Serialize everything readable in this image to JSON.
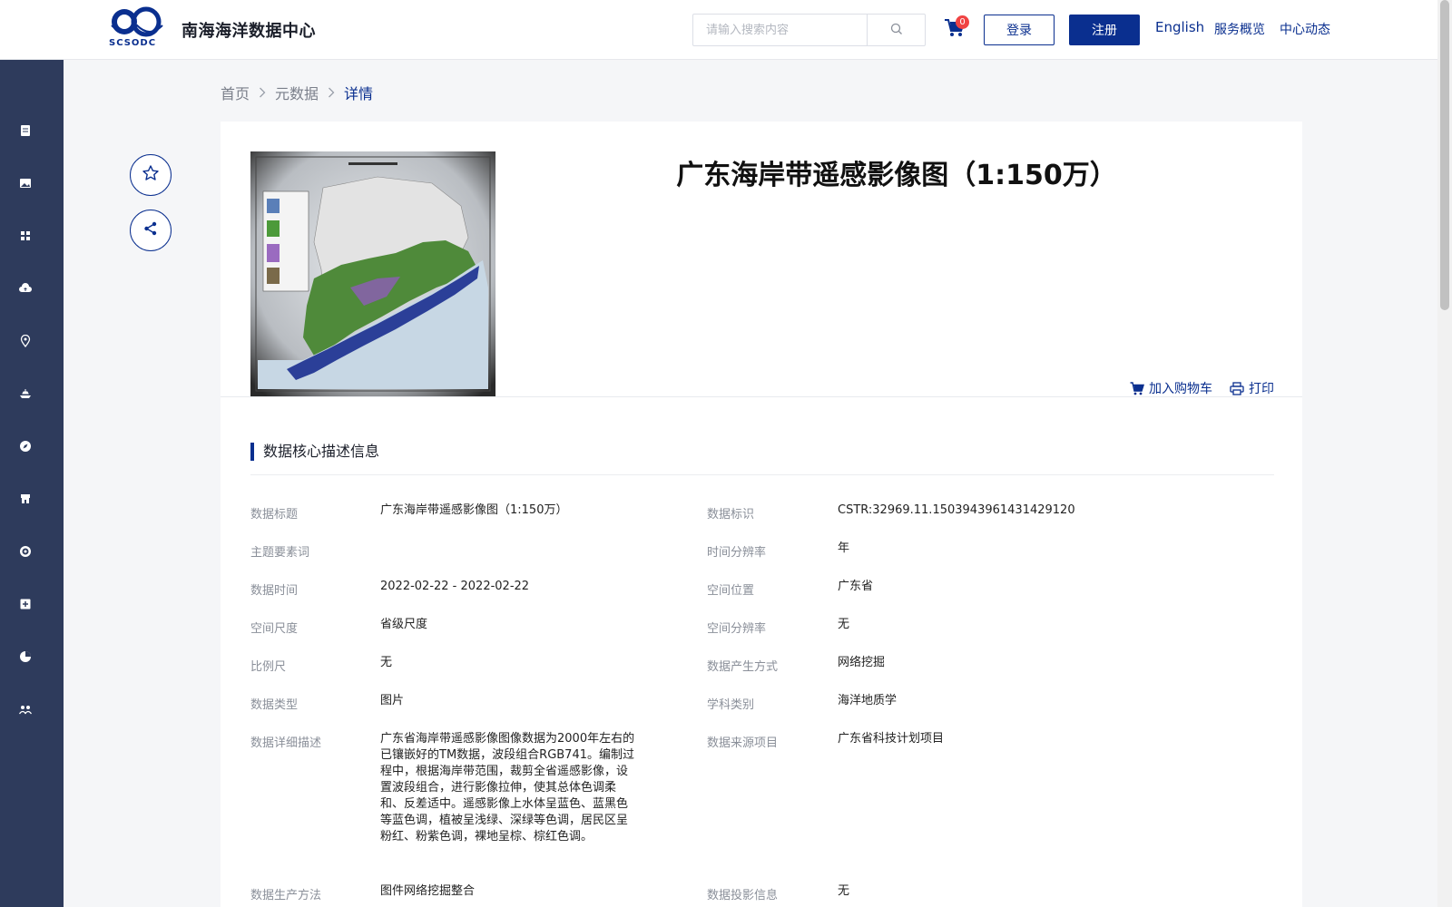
{
  "header": {
    "site_title": "南海海洋数据中心",
    "logo_text": "SCSODC",
    "search_placeholder": "请输入搜索内容",
    "cart_count": "0",
    "login_label": "登录",
    "register_label": "注册",
    "english_label": "English",
    "services_label": "服务概览",
    "news_label": "中心动态"
  },
  "sidebar": {
    "items": [
      "document",
      "image",
      "grid",
      "cloud-upload",
      "location",
      "ship",
      "compass",
      "store",
      "target",
      "plus-box",
      "pie-chart",
      "team"
    ]
  },
  "breadcrumb": {
    "home": "首页",
    "metadata": "元数据",
    "current": "详情"
  },
  "detail": {
    "title": "广东海岸带遥感影像图（1:150万）",
    "add_to_cart": "加入购物车",
    "print": "打印",
    "section_title": "数据核心描述信息"
  },
  "fields": {
    "title_label": "数据标题",
    "title_value": "广东海岸带遥感影像图（1:150万）",
    "id_label": "数据标识",
    "id_value": "CSTR:32969.11.1503943961431429120",
    "keywords_label": "主题要素词",
    "keywords_value": "",
    "time_res_label": "时间分辨率",
    "time_res_value": "年",
    "time_label": "数据时间",
    "time_value": "2022-02-22 - 2022-02-22",
    "location_label": "空间位置",
    "location_value": "广东省",
    "scale_label": "空间尺度",
    "scale_value": "省级尺度",
    "spatial_res_label": "空间分辨率",
    "spatial_res_value": "无",
    "ratio_label": "比例尺",
    "ratio_value": "无",
    "method_label": "数据产生方式",
    "method_value": "网络挖掘",
    "type_label": "数据类型",
    "type_value": "图片",
    "subject_label": "学科类别",
    "subject_value": "海洋地质学",
    "desc_label": "数据详细描述",
    "desc_value": "广东省海岸带遥感影像图像数据为2000年左右的已镶嵌好的TM数据，波段组合RGB741。编制过程中，根据海岸带范围，裁剪全省遥感影像，设置波段组合，进行影像拉伸，使其总体色调柔和、反差适中。遥感影像上水体呈蓝色、蓝黑色等蓝色调，植被呈浅绿、深绿等色调，居民区呈粉红、粉紫色调，裸地呈棕、棕红色调。",
    "project_label": "数据来源项目",
    "project_value": "广东省科技计划项目",
    "production_label": "数据生产方法",
    "production_value": "图件网络挖掘整合",
    "projection_label": "数据投影信息",
    "projection_value": "无"
  },
  "colors": {
    "primary": "#0a2f8f",
    "sidebar": "#2e3b5c",
    "badge": "#f04343"
  }
}
